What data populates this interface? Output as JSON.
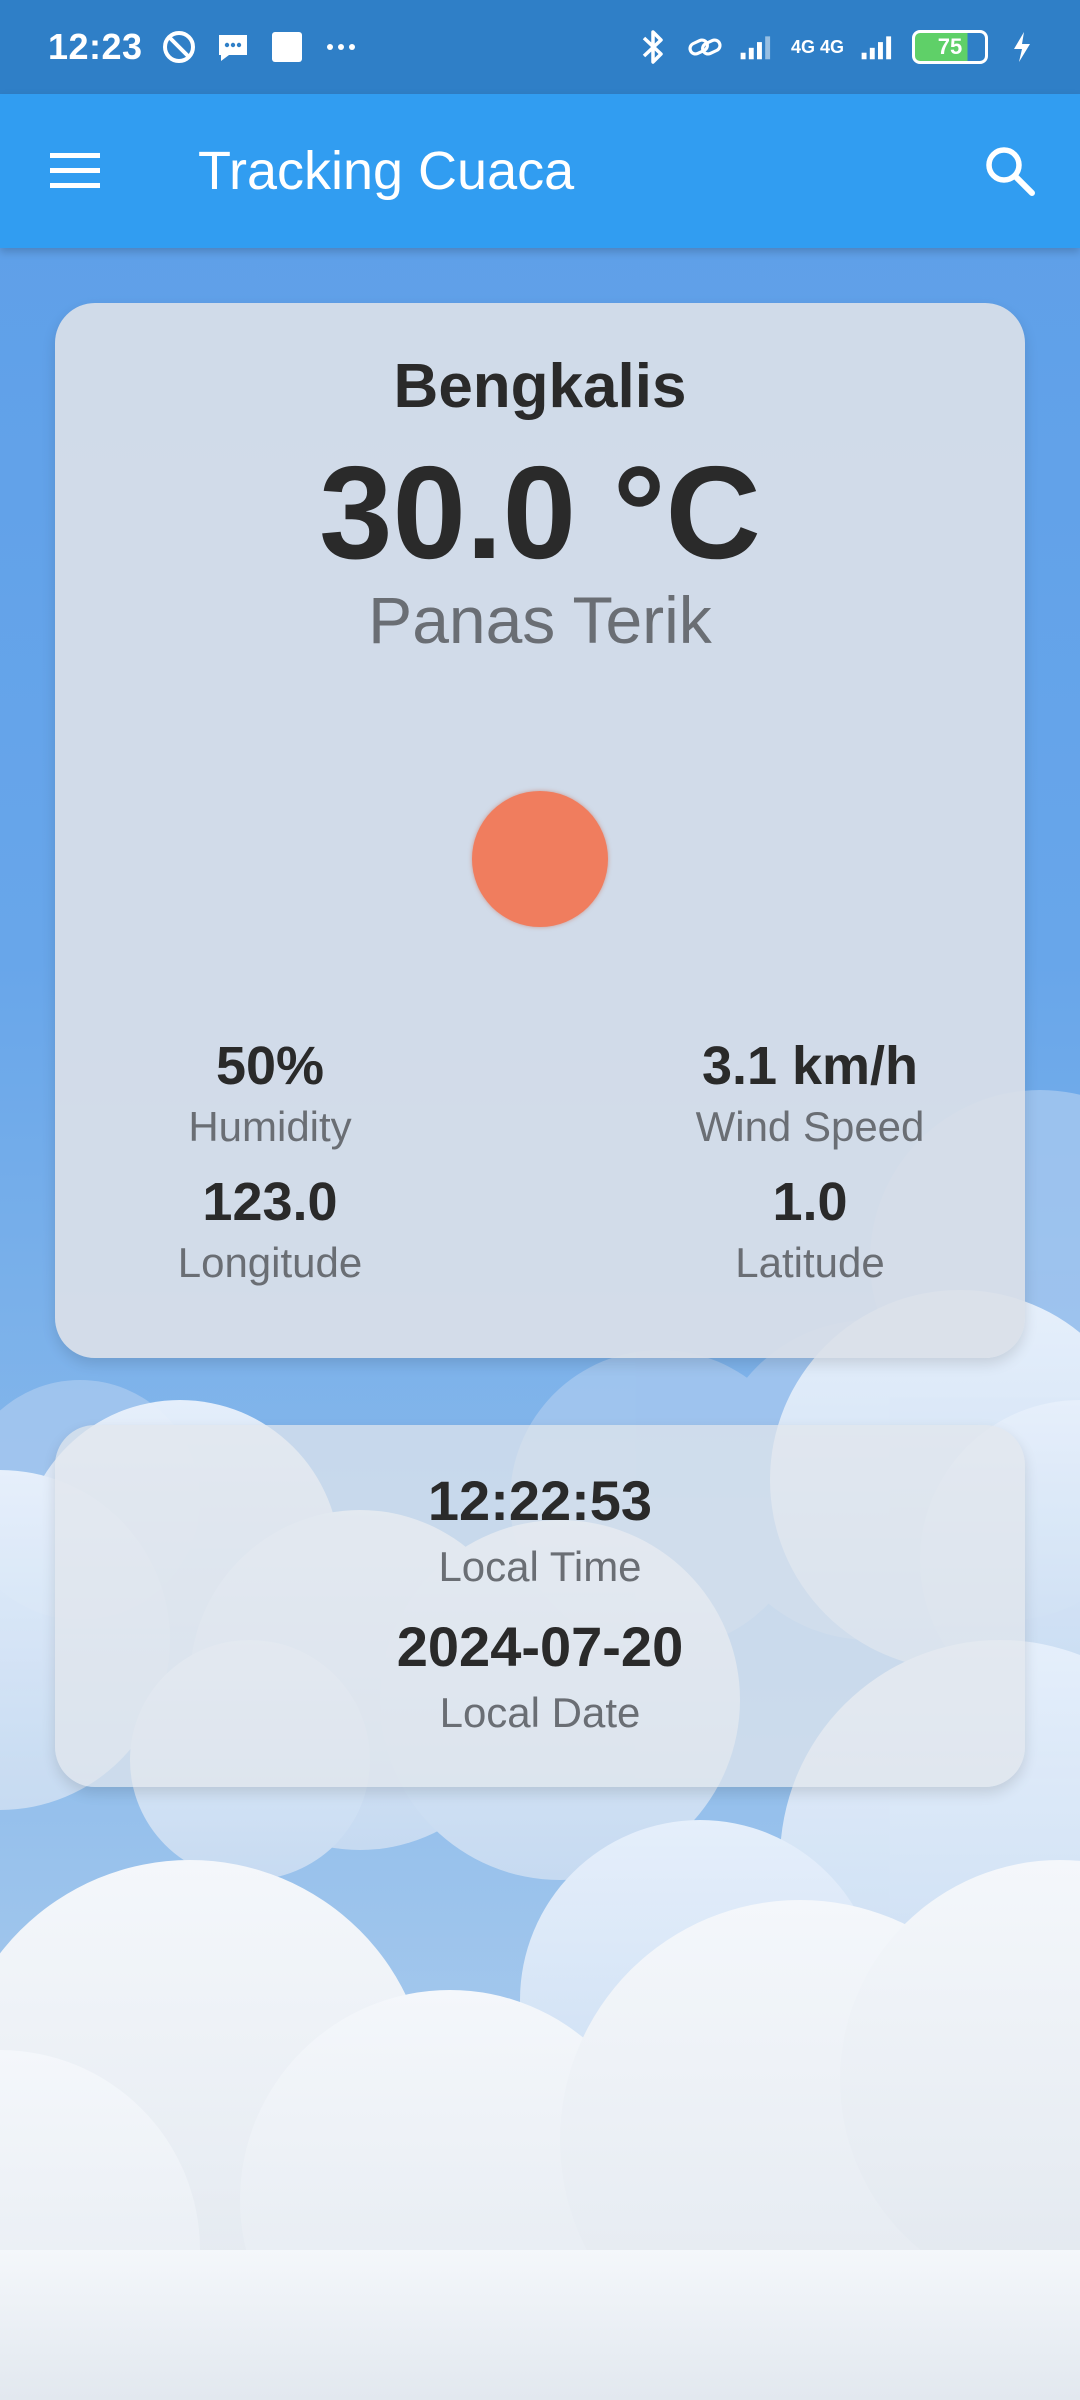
{
  "status_bar": {
    "time": "12:23",
    "network_label": "4G 4G",
    "battery": "75"
  },
  "app_bar": {
    "title": "Tracking Cuaca"
  },
  "weather": {
    "city": "Bengkalis",
    "temperature": "30.0 °C",
    "condition": "Panas Terik",
    "stats": [
      {
        "value": "50%",
        "label": "Humidity"
      },
      {
        "value": "3.1 km/h",
        "label": "Wind Speed"
      },
      {
        "value": "123.0",
        "label": "Longitude"
      },
      {
        "value": "1.0",
        "label": "Latitude"
      }
    ]
  },
  "local": {
    "time": "12:22:53",
    "time_label": "Local Time",
    "date": "2024-07-20",
    "date_label": "Local Date"
  },
  "colors": {
    "status_bar": "#2f7fc7",
    "app_bar": "#319df1",
    "sun": "#f07d5e"
  }
}
